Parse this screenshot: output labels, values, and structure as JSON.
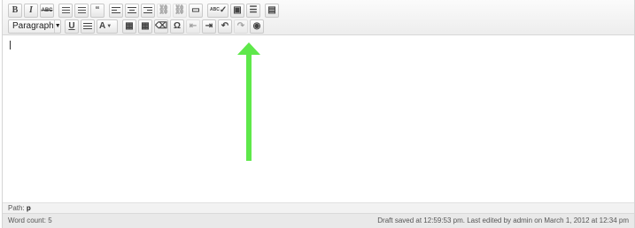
{
  "toolbar": {
    "row1": [
      {
        "name": "bold-button",
        "icon": "B",
        "label": "B",
        "style": "serif-bold"
      },
      {
        "name": "italic-button",
        "icon": "I",
        "label": "I",
        "style": "serif-italic"
      },
      {
        "name": "strikethrough-button",
        "icon": "ABC",
        "label": "ABC",
        "style": "strike-small"
      },
      {
        "name": "sep"
      },
      {
        "name": "bullet-list-button",
        "icon": "bullet-list-icon"
      },
      {
        "name": "numbered-list-button",
        "icon": "numbered-list-icon"
      },
      {
        "name": "blockquote-button",
        "icon": "quote-icon",
        "label": "“"
      },
      {
        "name": "sep"
      },
      {
        "name": "align-left-button",
        "icon": "align-left-icon"
      },
      {
        "name": "align-center-button",
        "icon": "align-center-icon"
      },
      {
        "name": "align-right-button",
        "icon": "align-right-icon"
      },
      {
        "name": "link-button",
        "icon": "link-icon",
        "disabled": true
      },
      {
        "name": "unlink-button",
        "icon": "unlink-icon",
        "disabled": true
      },
      {
        "name": "more-tag-button",
        "icon": "more-tag-icon"
      },
      {
        "name": "sep"
      },
      {
        "name": "spellcheck-button",
        "icon": "spellcheck-icon",
        "label": "ABC",
        "dropdown": true
      },
      {
        "name": "fullscreen-button",
        "icon": "fullscreen-icon"
      },
      {
        "name": "kitchen-sink-button",
        "icon": "kitchen-sink-icon"
      },
      {
        "name": "sep"
      },
      {
        "name": "extra-button",
        "icon": "document-icon"
      }
    ],
    "format_select": {
      "value": "Paragraph"
    },
    "row2": [
      {
        "name": "underline-button",
        "icon": "U",
        "label": "U",
        "style": "underline"
      },
      {
        "name": "justify-button",
        "icon": "justify-icon"
      },
      {
        "name": "text-color-button",
        "icon": "text-color-icon",
        "label": "A",
        "dropdown": true
      },
      {
        "name": "sep"
      },
      {
        "name": "paste-text-button",
        "icon": "paste-text-icon"
      },
      {
        "name": "paste-word-button",
        "icon": "paste-word-icon"
      },
      {
        "name": "remove-format-button",
        "icon": "eraser-icon"
      },
      {
        "name": "special-char-button",
        "icon": "omega-icon",
        "label": "Ω"
      },
      {
        "name": "outdent-button",
        "icon": "outdent-icon",
        "disabled": true
      },
      {
        "name": "indent-button",
        "icon": "indent-icon"
      },
      {
        "name": "undo-button",
        "icon": "undo-icon",
        "label": "↶"
      },
      {
        "name": "redo-button",
        "icon": "redo-icon",
        "label": "↷",
        "disabled": true
      },
      {
        "name": "help-button",
        "icon": "help-icon"
      }
    ]
  },
  "path": {
    "label": "Path:",
    "value": "p"
  },
  "status": {
    "word_count": "Word count: 5",
    "draft_saved": "Draft saved at 12:59:53 pm. Last edited by admin on March 1, 2012 at 12:34 pm"
  },
  "colors": {
    "arrow": "#5ee84a"
  }
}
